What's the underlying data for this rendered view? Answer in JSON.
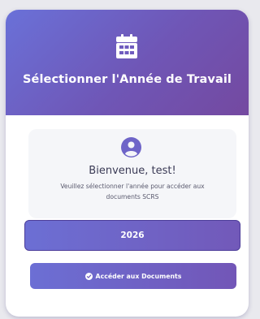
{
  "header": {
    "icon": "calendar-icon",
    "title": "Sélectionner l'Année de Travail"
  },
  "welcome": {
    "icon": "user-circle-icon",
    "title": "Bienvenue, test!",
    "message": "Veuillez sélectionner l'année pour accéder aux documents SCRS"
  },
  "year_select": {
    "selected_value": "2026"
  },
  "access_button": {
    "icon": "check-circle-icon",
    "label": "Accéder aux Documents"
  },
  "colors": {
    "primary": "#6c6fd4",
    "secondary": "#7449a0",
    "card_background": "#ffffff",
    "panel_background": "#f5f6f9"
  }
}
